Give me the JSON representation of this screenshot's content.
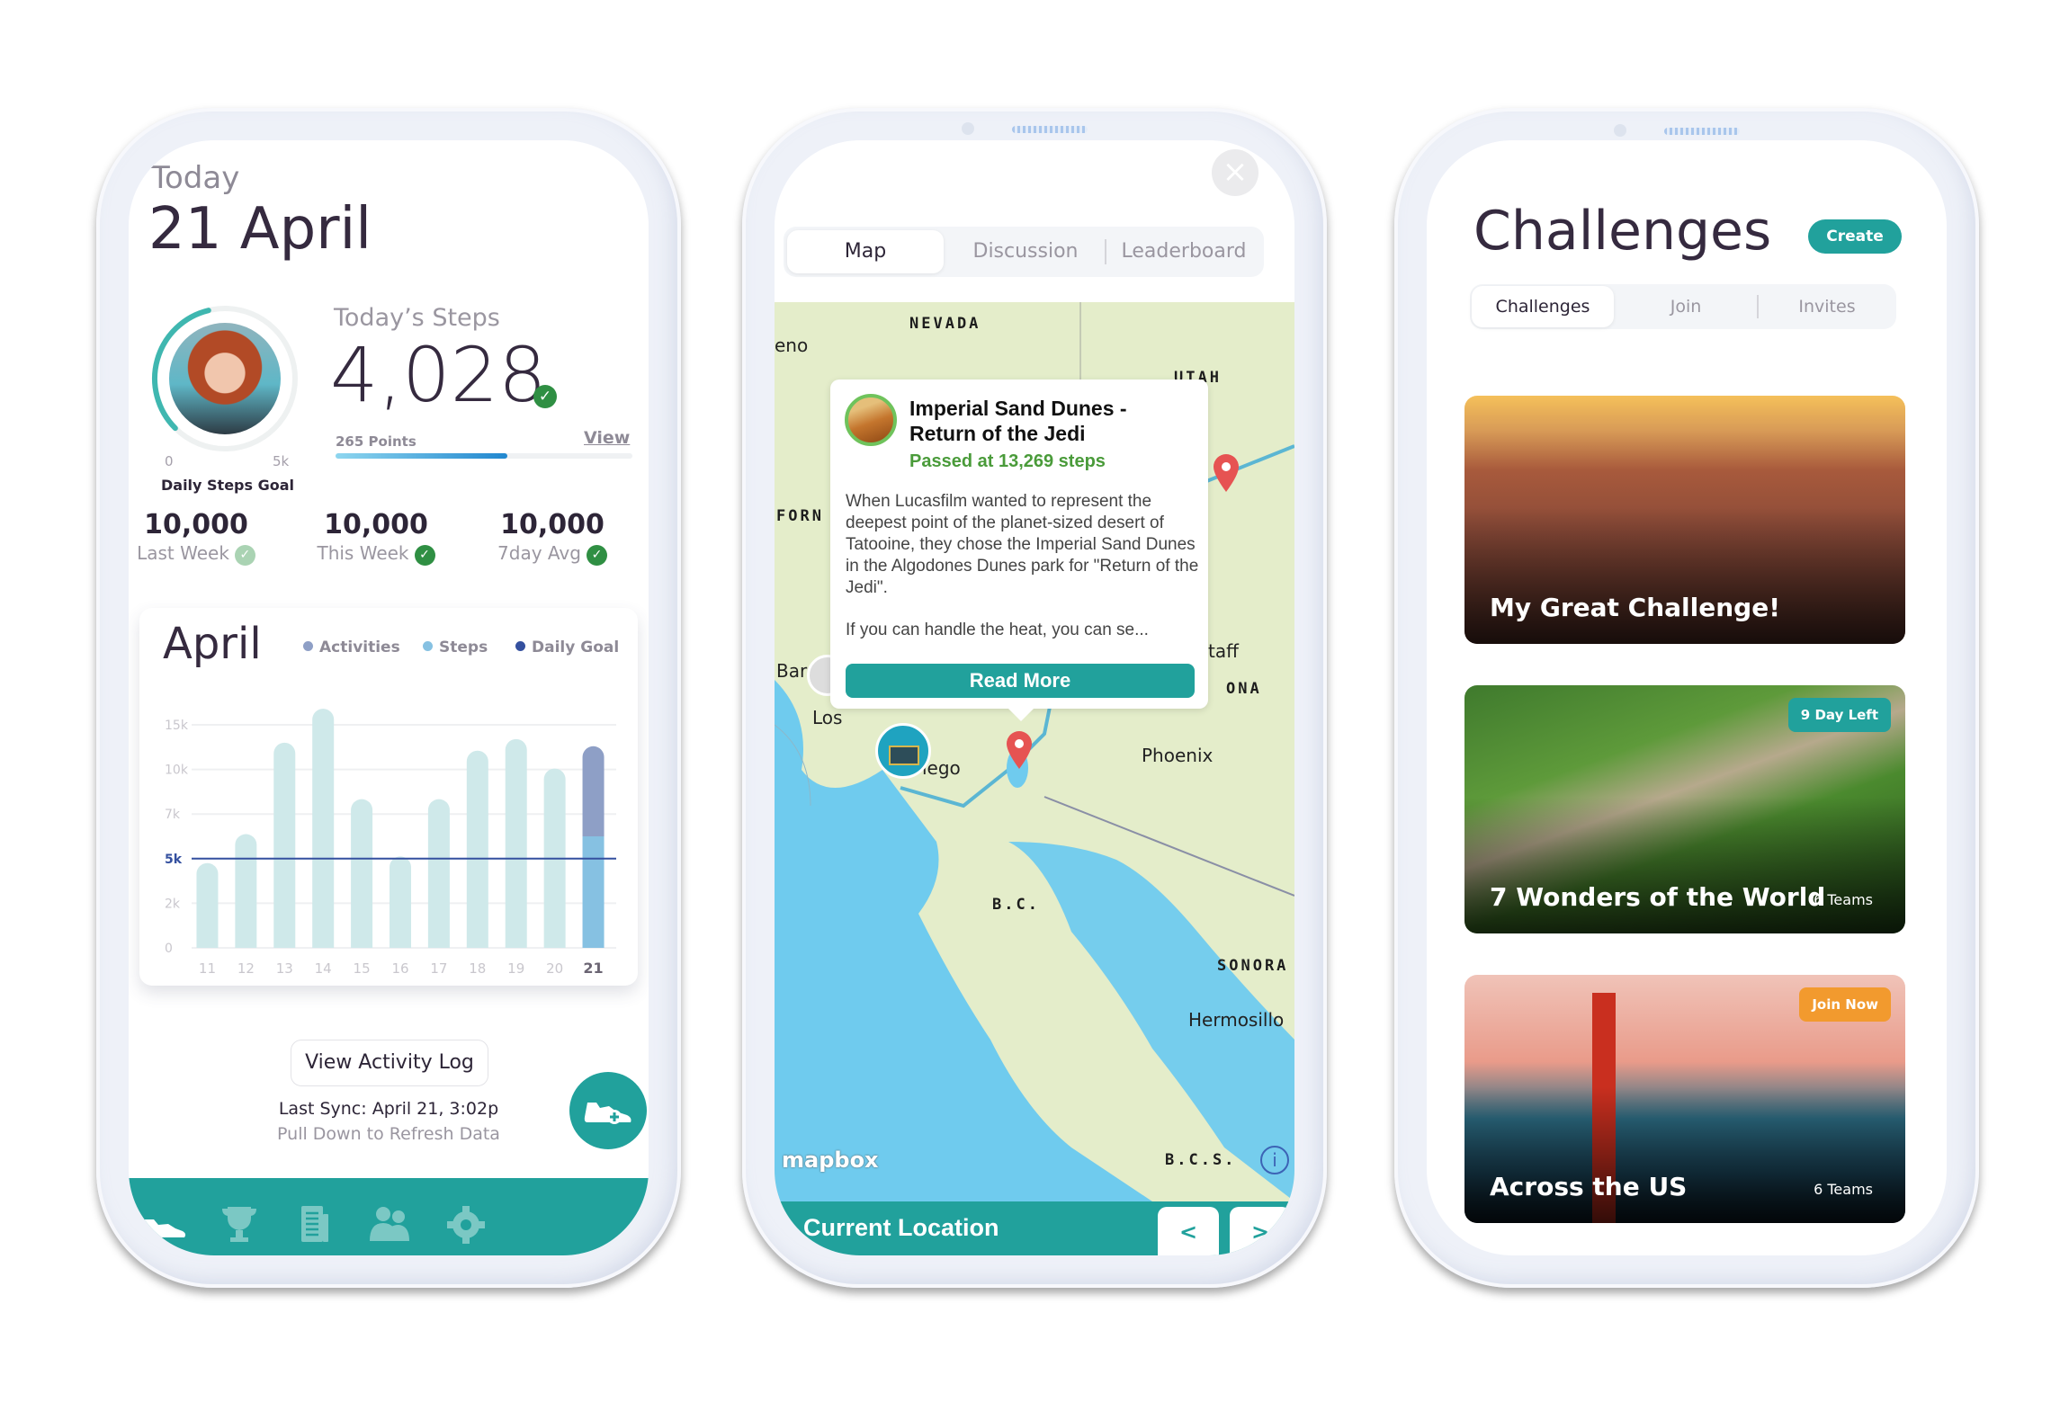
{
  "colors": {
    "teal": "#21a19c",
    "dark_text": "#352a3f",
    "muted_text": "#9a96a0",
    "success_green": "#2f8f43",
    "orange": "#f29a2e"
  },
  "home": {
    "today_label": "Today",
    "date_title": "21 April",
    "ring": {
      "min_label": "0",
      "max_label": "5k",
      "caption": "Daily Steps Goal",
      "progress_fraction": 0.45
    },
    "steps_label": "Today’s Steps",
    "steps_value": "4,028",
    "check_icon": "✓",
    "points_label": "265 Points",
    "points_progress_fraction": 0.58,
    "view_link": "View",
    "stats": [
      {
        "value": "10,000",
        "label": "Last Week",
        "status": "light"
      },
      {
        "value": "10,000",
        "label": "This Week",
        "status": "done"
      },
      {
        "value": "10,000",
        "label": "7day Avg",
        "status": "done"
      }
    ],
    "activity_button": "View Activity Log",
    "last_sync": "Last Sync: April 21, 3:02p",
    "refresh_hint": "Pull Down to Refresh Data",
    "tabs": [
      {
        "name": "steps",
        "icon": "shoe-icon",
        "active": true
      },
      {
        "name": "challenges",
        "icon": "trophy-icon",
        "active": false
      },
      {
        "name": "news",
        "icon": "newspaper-icon",
        "active": false
      },
      {
        "name": "friends",
        "icon": "people-icon",
        "active": false
      },
      {
        "name": "settings",
        "icon": "gear-icon",
        "active": false
      }
    ]
  },
  "chart_data": {
    "type": "bar",
    "title": "April",
    "legend": [
      {
        "name": "Activities",
        "color": "#8e9fc6"
      },
      {
        "name": "Steps",
        "color": "#86c1e2"
      },
      {
        "name": "Daily Goal",
        "color": "#34509f"
      }
    ],
    "legend_position": "top-right",
    "categories": [
      "11",
      "12",
      "13",
      "14",
      "15",
      "16",
      "17",
      "18",
      "19",
      "20",
      "21"
    ],
    "highlight_category": "21",
    "y_ticks": [
      "0",
      "2k",
      "5k",
      "7k",
      "10k",
      "15k"
    ],
    "y_tick_values": [
      0,
      2000,
      5000,
      7000,
      10000,
      15000
    ],
    "series": [
      {
        "name": "Steps",
        "values": [
          4700,
          6100,
          13000,
          16800,
          8000,
          5100,
          8000,
          12100,
          13400,
          10100,
          6000
        ]
      },
      {
        "name": "Activities",
        "values": [
          0,
          0,
          0,
          0,
          0,
          0,
          0,
          0,
          0,
          0,
          6600
        ]
      }
    ],
    "daily_goal": 5000,
    "daily_goal_label": "5k",
    "past_bar_color": "#cfe9ea",
    "grid": true
  },
  "map_screen": {
    "close_icon": "×",
    "tabs": [
      {
        "label": "Map",
        "active": true
      },
      {
        "label": "Discussion",
        "active": false
      },
      {
        "label": "Leaderboard",
        "active": false
      }
    ],
    "map_labels": [
      "NEVADA",
      "UTAH",
      "FORN",
      "ONA",
      "B.C.",
      "SONORA",
      "B.C.S."
    ],
    "cities": [
      "eno",
      "Phoenix",
      "Hermosillo",
      "taff",
      "Bar",
      "Los",
      "iego"
    ],
    "popup": {
      "title": "Imperial Sand Dunes - Return of the Jedi",
      "status": "Passed at 13,269 steps",
      "body": "When Lucasfilm wanted to represent the deepest point of the planet-sized desert of Tatooine, they chose the Imperial Sand Dunes in the Algodones Dunes park for \"Return of the Jedi\".",
      "more": "If you can handle the heat, you can se...",
      "button": "Read More"
    },
    "attribution": "mapbox",
    "info_icon": "i",
    "footer_label": "Current Location",
    "prev_label": "<",
    "next_label": ">"
  },
  "challenges": {
    "title": "Challenges",
    "create_button": "Create",
    "tabs": [
      {
        "label": "Challenges",
        "active": true
      },
      {
        "label": "Join",
        "active": false
      },
      {
        "label": "Invites",
        "active": false
      }
    ],
    "cards": [
      {
        "title": "My Great Challenge!",
        "teams": "",
        "badge": ""
      },
      {
        "title": "7 Wonders of the World",
        "teams": "6 Teams",
        "badge": "9 Day Left",
        "badge_color": "#21a19c"
      },
      {
        "title": "Across the US",
        "teams": "6 Teams",
        "badge": "Join Now",
        "badge_color": "#f29a2e"
      }
    ]
  }
}
